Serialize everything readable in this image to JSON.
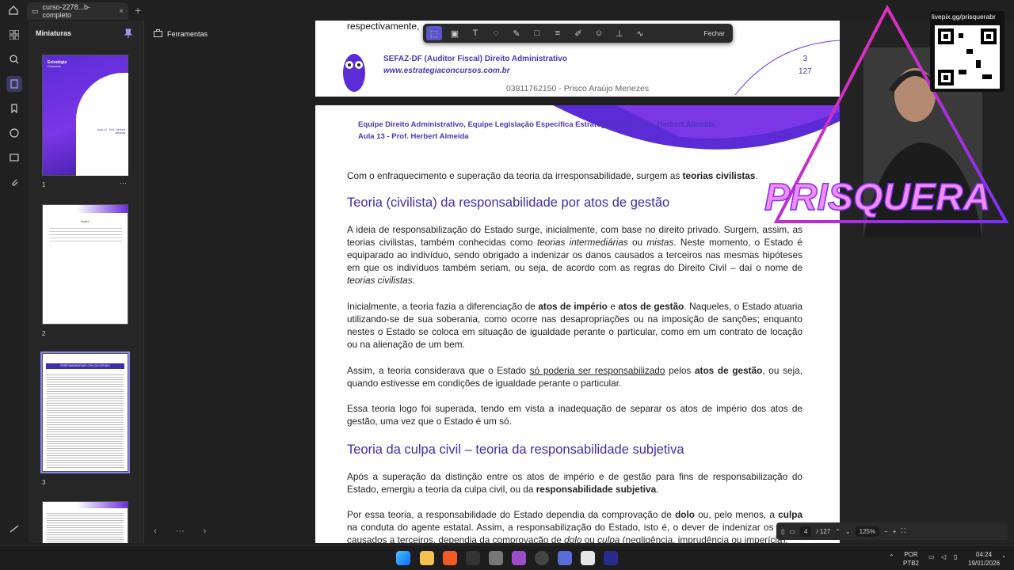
{
  "titlebar": {
    "tab_title": "curso-2278...b-completo",
    "close": "×",
    "new_tab": "+"
  },
  "thumbs_panel": {
    "title": "Miniaturas",
    "pages": [
      "1",
      "2",
      "3"
    ],
    "more": "···"
  },
  "thumb1": {
    "brand": "Estratégia",
    "sub": "Concursos",
    "aula": "Aula 13 - Prof. Herbert Almeida"
  },
  "thumb2": {
    "title": "Índice"
  },
  "thumb3": {
    "title": "RESPONSABILIDADE CIVIL DO ESTADO"
  },
  "tools_panel": {
    "label": "Ferramentas"
  },
  "toolbar": {
    "close": "Fechar"
  },
  "doc": {
    "prev_text": "respectivamente,",
    "footer_org": "SEFAZ-DF (Auditor Fiscal) Direito Administrativo",
    "footer_site": "www.estrategiaconcursos.com.br",
    "footer_page": "3",
    "footer_total": "127",
    "watermark": "03811762150 - Prisco Araújo Menezes",
    "header_line1": "Equipe Direito Administrativo, Equipe Legislação Específica Estratégia Concursos, Herbert Almeida",
    "header_line2": "Aula 13 - Prof. Herbert Almeida",
    "intro_a": "Com o enfraquecimento e superação da teoria da irresponsabilidade, surgem as ",
    "intro_b": "teorias civilistas",
    "intro_c": ".",
    "h_civilista": "Teoria (civilista) da responsabilidade por atos de gestão",
    "p1_a": "A ideia de responsabilização do Estado surge, inicialmente, com base no direito privado. Surgem, assim, as teorias civilistas, também conhecidas como ",
    "p1_b": "teorias intermediárias",
    "p1_c": " ou ",
    "p1_d": "mistas",
    "p1_e": ". Neste momento, o Estado é equiparado ao indivíduo, sendo obrigado a indenizar os danos causados a terceiros nas mesmas hipóteses em que os indivíduos também seriam, ou seja, de acordo com as regras do Direito Civil – daí o nome de ",
    "p1_f": "teorias civilistas",
    "p1_g": ".",
    "p2_a": "Inicialmente, a teoria fazia a diferenciação de ",
    "p2_b": "atos de império",
    "p2_c": " e ",
    "p2_d": "atos de gestão",
    "p2_e": ". Naqueles, o Estado atuaria utilizando-se de sua soberania, como ocorre nas desapropriações ou na imposição de sanções; enquanto nestes o Estado se coloca em situação de igualdade perante o particular, como em um contrato de locação ou na alienação de um bem.",
    "p3_a": "Assim, a teoria considerava que o Estado ",
    "p3_b": "só poderia ser responsabilizado",
    "p3_c": " pelos ",
    "p3_d": "atos de gestão",
    "p3_e": ", ou seja, quando estivesse em condições de igualdade perante o particular.",
    "p4": "Essa teoria logo foi superada, tendo em vista a inadequação de separar os atos de império dos atos de gestão, uma vez que o Estado é um só.",
    "h_culpa": "Teoria da culpa civil – teoria da responsabilidade subjetiva",
    "p5_a": "Após a superação da distinção entre os atos de império e de gestão para fins de responsabilização do Estado, emergiu a teoria da culpa civil, ou da ",
    "p5_b": "responsabilidade subjetiva",
    "p5_c": ".",
    "p6_a": "Por essa teoria, a responsabilidade do Estado dependia da comprovação de ",
    "p6_b": "dolo",
    "p6_c": " ou, pelo menos, a ",
    "p6_d": "culpa",
    "p6_e": " na conduta do agente estatal. Assim, a responsabilização do Estado, isto é, o dever de indenizar os danos causados a terceiros, dependia da comprovação de ",
    "p6_f": "dolo",
    "p6_g": " ou ",
    "p6_h": "culpa",
    "p6_i": " (negligência, imprudência ou imperícia)."
  },
  "zoombar": {
    "page": "4",
    "total": "/ 127",
    "zoom": "125%"
  },
  "stream": {
    "handle": "livepix.gg/prisquerabr",
    "brand": "PRISQUERA"
  },
  "tray": {
    "lang1": "POR",
    "lang2": "PTB2",
    "time": "04:24",
    "date": "19/01/2026"
  },
  "colors": {
    "accent": "#4b37b5",
    "heading": "#3d2eaa",
    "panel": "#262626"
  }
}
